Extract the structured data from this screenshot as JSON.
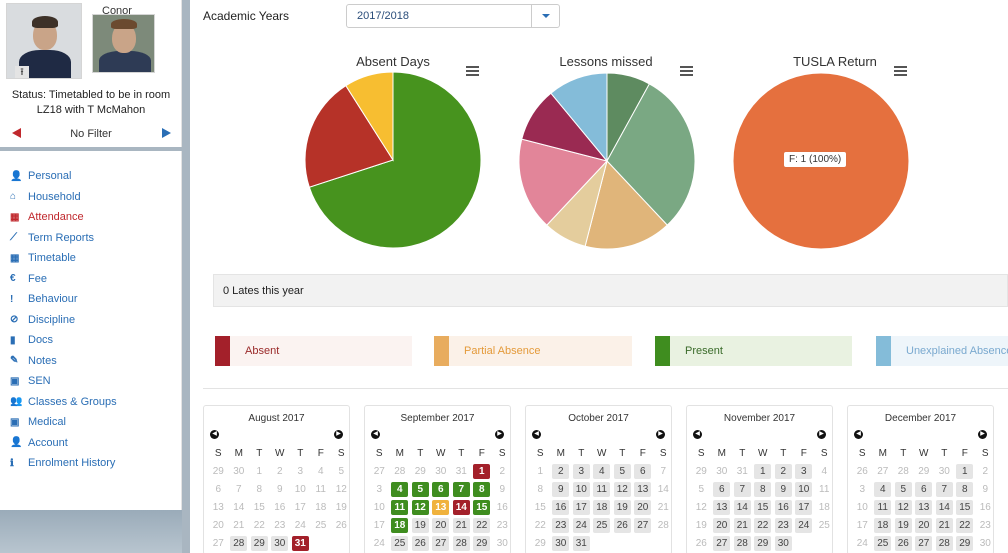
{
  "student": {
    "name": "Conor",
    "status": [
      "Status: Timetabled to be in room",
      "LZ18 with T McMahon"
    ],
    "filter_label": "No Filter"
  },
  "nav": [
    {
      "label": "Personal",
      "icon": "person-icon",
      "glyph": "👤"
    },
    {
      "label": "Household",
      "icon": "home-icon",
      "glyph": "⌂"
    },
    {
      "label": "Attendance",
      "icon": "calendar-icon",
      "glyph": "▦"
    },
    {
      "label": "Term Reports",
      "icon": "line-chart-icon",
      "glyph": "⟋"
    },
    {
      "label": "Timetable",
      "icon": "calendar-icon",
      "glyph": "▦"
    },
    {
      "label": "Fee",
      "icon": "euro-icon",
      "glyph": "€"
    },
    {
      "label": "Behaviour",
      "icon": "exclamation-icon",
      "glyph": "!"
    },
    {
      "label": "Discipline",
      "icon": "ban-icon",
      "glyph": "⊘"
    },
    {
      "label": "Docs",
      "icon": "document-icon",
      "glyph": "▮"
    },
    {
      "label": "Notes",
      "icon": "edit-icon",
      "glyph": "✎"
    },
    {
      "label": "SEN",
      "icon": "medkit-icon",
      "glyph": "▣"
    },
    {
      "label": "Classes & Groups",
      "icon": "group-icon",
      "glyph": "👥"
    },
    {
      "label": "Medical",
      "icon": "medkit-icon",
      "glyph": "▣"
    },
    {
      "label": "Account",
      "icon": "person-icon",
      "glyph": "👤"
    },
    {
      "label": "Enrolment History",
      "icon": "info-icon",
      "glyph": "ℹ"
    }
  ],
  "active_nav": "Attendance",
  "academic_years": {
    "label": "Academic Years",
    "value": "2017/2018"
  },
  "charts": {
    "absent_days": {
      "title": "Absent Days"
    },
    "lessons_missed": {
      "title": "Lessons missed"
    },
    "tusla_return": {
      "title": "TUSLA Return",
      "tooltip": "F: 1 (100%)"
    }
  },
  "chart_data": [
    {
      "type": "pie",
      "title": "Absent Days",
      "slices": [
        {
          "value": 70,
          "color": "#47931e"
        },
        {
          "value": 21,
          "color": "#b63228"
        },
        {
          "value": 9,
          "color": "#f7be31"
        }
      ]
    },
    {
      "type": "pie",
      "title": "Lessons missed",
      "slices": [
        {
          "value": 8,
          "color": "#5e8b60"
        },
        {
          "value": 30,
          "color": "#7aa883"
        },
        {
          "value": 16,
          "color": "#e0b57a"
        },
        {
          "value": 8,
          "color": "#e4cd9d"
        },
        {
          "value": 17,
          "color": "#e28599"
        },
        {
          "value": 10,
          "color": "#9a2a52"
        },
        {
          "value": 11,
          "color": "#84bcd9"
        }
      ]
    },
    {
      "type": "pie",
      "title": "TUSLA Return",
      "slices": [
        {
          "label": "F",
          "value": 1,
          "color": "#e5703e"
        }
      ]
    }
  ],
  "lates_text": "0 Lates this year",
  "legend": [
    {
      "label": "Absent",
      "color": "#a3202a",
      "bg": "#fbf3f1",
      "text_color": "#9a2a2a"
    },
    {
      "label": "Partial Absence",
      "color": "#e8ac5e",
      "bg": "#fbf1e8",
      "text_color": "#e49a3a"
    },
    {
      "label": "Present",
      "color": "#3f8d1f",
      "bg": "#e9f2e1",
      "text_color": "#3a6b2a"
    },
    {
      "label": "Unexplained Absence",
      "color": "#84bcd9",
      "bg": "#eef5fa",
      "text_color": "#7aa9cf"
    }
  ],
  "weekday_labels": [
    "S",
    "M",
    "T",
    "W",
    "T",
    "F",
    "S"
  ],
  "calendars": [
    {
      "title": "August 2017",
      "first_day": 2,
      "days_in_month": 31,
      "prev_days": 30,
      "school_days": [
        28,
        29,
        30,
        31
      ],
      "status": {
        "31": "absent"
      }
    },
    {
      "title": "September 2017",
      "first_day": 5,
      "days_in_month": 30,
      "prev_days": 31,
      "school_days": [
        1,
        4,
        5,
        6,
        7,
        8,
        11,
        12,
        13,
        14,
        15,
        18,
        19,
        20,
        21,
        22,
        25,
        26,
        27,
        28,
        29
      ],
      "status": {
        "1": "absent",
        "4": "present",
        "5": "present",
        "6": "present",
        "7": "present",
        "8": "present",
        "11": "present",
        "12": "present",
        "13": "partial",
        "14": "absent",
        "15": "present",
        "18": "present"
      }
    },
    {
      "title": "October 2017",
      "first_day": 0,
      "days_in_month": 31,
      "prev_days": 30,
      "school_days": [
        2,
        3,
        4,
        5,
        6,
        9,
        10,
        11,
        12,
        13,
        16,
        17,
        18,
        19,
        20,
        23,
        24,
        25,
        26,
        27,
        30,
        31
      ],
      "status": {}
    },
    {
      "title": "November 2017",
      "first_day": 3,
      "days_in_month": 30,
      "prev_days": 31,
      "school_days": [
        1,
        2,
        3,
        6,
        7,
        8,
        9,
        10,
        13,
        14,
        15,
        16,
        17,
        20,
        21,
        22,
        23,
        24,
        27,
        28,
        29,
        30
      ],
      "status": {}
    },
    {
      "title": "December 2017",
      "first_day": 5,
      "days_in_month": 31,
      "prev_days": 30,
      "school_days": [
        1,
        4,
        5,
        6,
        7,
        8,
        11,
        12,
        13,
        14,
        15,
        18,
        19,
        20,
        21,
        22,
        25,
        26,
        27,
        28,
        29
      ],
      "status": {}
    }
  ]
}
